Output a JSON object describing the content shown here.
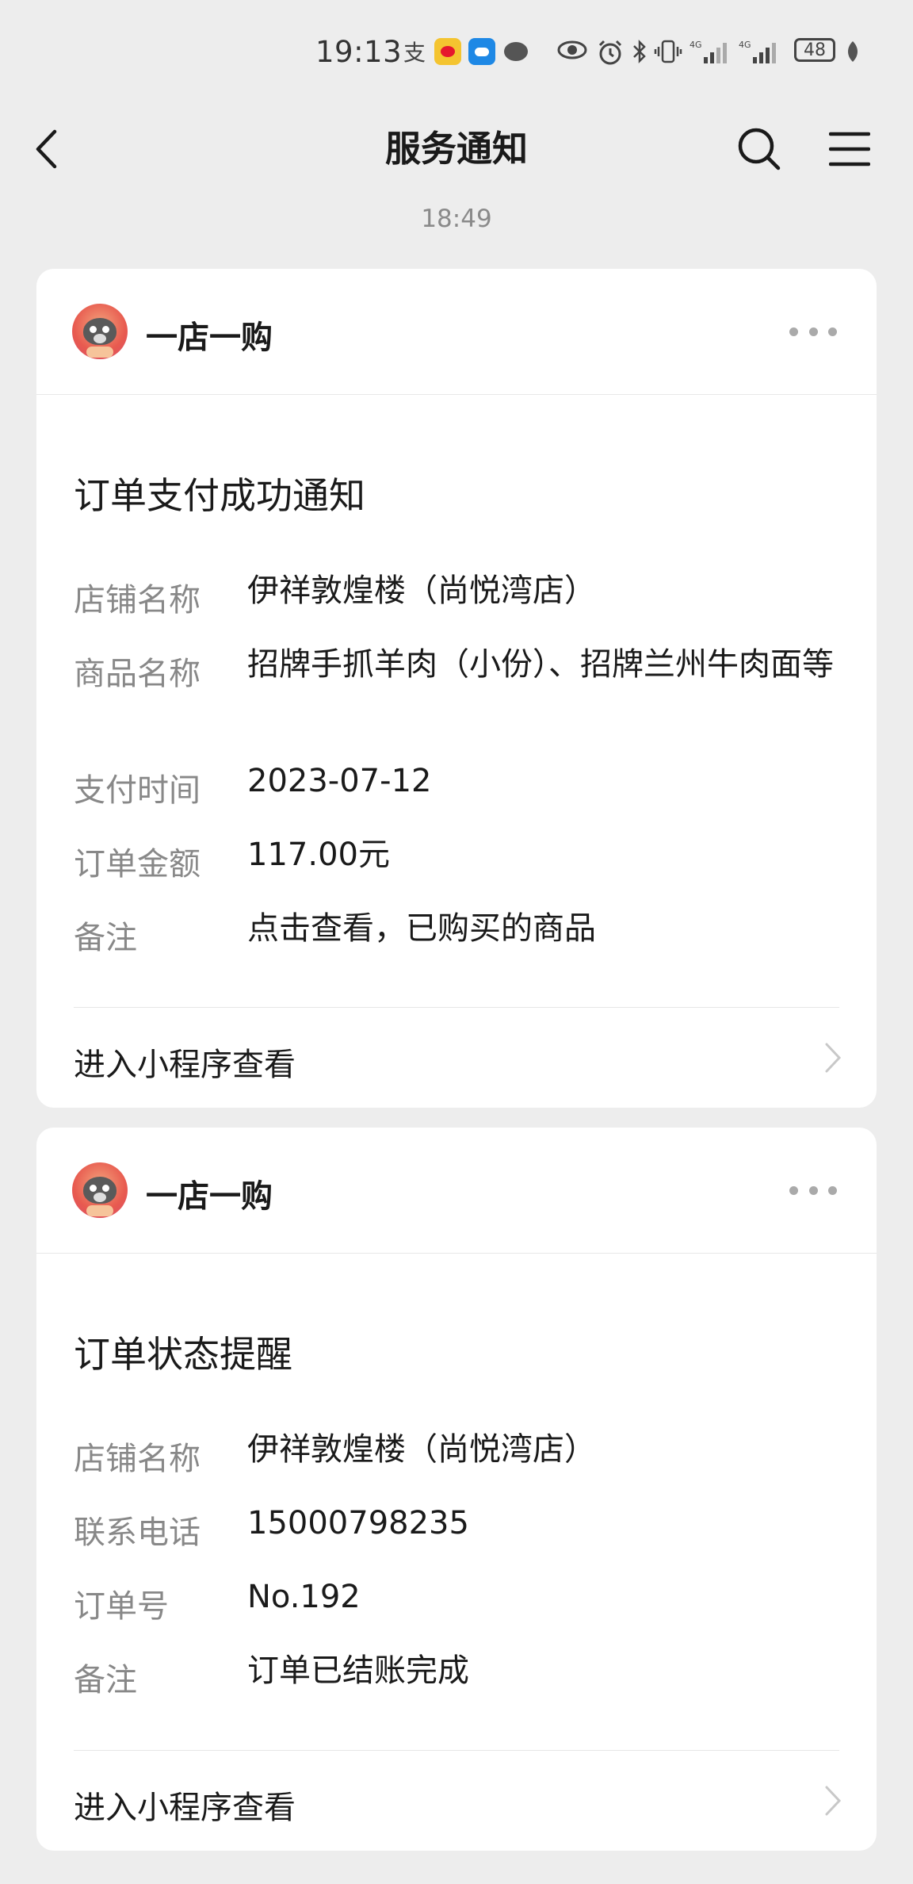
{
  "status_bar": {
    "time": "19:13",
    "battery": "48",
    "signal_1": "4G",
    "signal_2": "4G"
  },
  "nav": {
    "title": "服务通知"
  },
  "timestamp": "18:49",
  "cards": [
    {
      "shop_name": "一店一购",
      "title": "订单支付成功通知",
      "rows": [
        {
          "label": "店铺名称",
          "value": "伊祥敦煌楼（尚悦湾店）"
        },
        {
          "label": "商品名称",
          "value": "招牌手抓羊肉（小份）、招牌兰州牛肉面等"
        },
        {
          "label": "支付时间",
          "value": "2023-07-12"
        },
        {
          "label": "订单金额",
          "value": "117.00元"
        },
        {
          "label": "备注",
          "value": "点击查看，已购买的商品"
        }
      ],
      "link": "进入小程序查看"
    },
    {
      "shop_name": "一店一购",
      "title": "订单状态提醒",
      "rows": [
        {
          "label": "店铺名称",
          "value": "伊祥敦煌楼（尚悦湾店）"
        },
        {
          "label": "联系电话",
          "value": "15000798235"
        },
        {
          "label": "订单号",
          "value": "No.192"
        },
        {
          "label": "备注",
          "value": "订单已结账完成"
        }
      ],
      "link": "进入小程序查看"
    }
  ],
  "icons": {
    "back": "chevron-left-icon",
    "search": "search-icon",
    "menu": "menu-icon",
    "more": "more-horizontal-icon",
    "link_arrow": "chevron-right-icon"
  },
  "colors": {
    "background": "#ededed",
    "card": "#ffffff",
    "label": "#888888",
    "text": "#1a1a1a"
  }
}
